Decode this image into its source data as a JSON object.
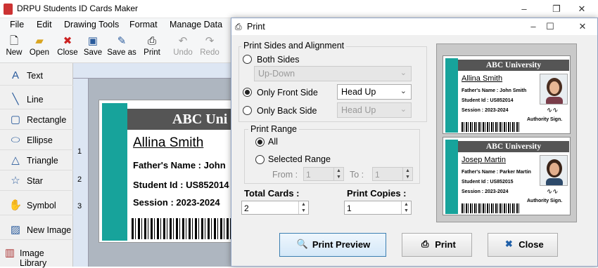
{
  "app": {
    "title": "DRPU Students ID Cards Maker"
  },
  "window_controls": {
    "minimize": "–",
    "maximize": "❐",
    "close": "✕"
  },
  "menu": [
    "File",
    "Edit",
    "Drawing Tools",
    "Format",
    "Manage Data"
  ],
  "toolbar": [
    {
      "label": "New",
      "icon": "new-file-icon",
      "enabled": true
    },
    {
      "label": "Open",
      "icon": "folder-icon",
      "enabled": true
    },
    {
      "label": "Close",
      "icon": "close-file-icon",
      "enabled": true
    },
    {
      "label": "Save",
      "icon": "save-icon",
      "enabled": true
    },
    {
      "label": "Save as",
      "icon": "save-as-icon",
      "enabled": true
    },
    {
      "label": "Print",
      "icon": "printer-icon",
      "enabled": true
    },
    {
      "label": "Undo",
      "icon": "undo-icon",
      "enabled": false
    },
    {
      "label": "Redo",
      "icon": "redo-icon",
      "enabled": false
    }
  ],
  "tools": [
    {
      "label": "Text",
      "icon": "text-icon"
    },
    {
      "label": "Line",
      "icon": "line-icon"
    },
    {
      "label": "Rectangle",
      "icon": "rectangle-icon"
    },
    {
      "label": "Ellipse",
      "icon": "ellipse-icon"
    },
    {
      "label": "Triangle",
      "icon": "triangle-icon"
    },
    {
      "label": "Star",
      "icon": "star-icon"
    },
    {
      "label": "Symbol",
      "icon": "symbol-icon"
    },
    {
      "label": "New Image",
      "icon": "image-icon"
    },
    {
      "label": "Image Library",
      "icon": "library-icon"
    }
  ],
  "ruler_marks": [
    "1",
    "2",
    "3"
  ],
  "design_card": {
    "header": "ABC Uni",
    "name": "Allina Smith",
    "father": "Father's Name :  John",
    "student_id": "Student Id :  US852014",
    "session": "Session :  2023-2024"
  },
  "dialog": {
    "title": "Print",
    "sides_group": "Print Sides and Alignment",
    "both_sides": "Both Sides",
    "both_sides_option": "Up-Down",
    "front_side": "Only Front Side",
    "front_option": "Head Up",
    "back_side": "Only Back Side",
    "back_option": "Head Up",
    "selected_side": "front",
    "range_group": "Print Range",
    "range_all": "All",
    "range_selected": "Selected Range",
    "from_label": "From :",
    "from_value": "1",
    "to_label": "To :",
    "to_value": "1",
    "total_cards_label": "Total Cards :",
    "total_cards_value": "2",
    "copies_label": "Print Copies :",
    "copies_value": "1",
    "btn_preview": "Print Preview",
    "btn_print": "Print",
    "btn_close": "Close"
  },
  "preview_cards": [
    {
      "header": "ABC University",
      "name": "Allina Smith",
      "father": "Father's Name :  John Smith",
      "student_id": "Student Id :  US852014",
      "session": "Session :  2023-2024",
      "authority": "Authority Sign."
    },
    {
      "header": "ABC University",
      "name": "Josep Martin",
      "father": "Father's Name :  Parker Martin",
      "student_id": "Student Id :  US852015",
      "session": "Session :  2023-2024",
      "authority": "Authority Sign."
    }
  ],
  "colors": {
    "accent": "#17a39b",
    "header_bar": "#555555",
    "dialog_border": "#8fa3c4"
  }
}
